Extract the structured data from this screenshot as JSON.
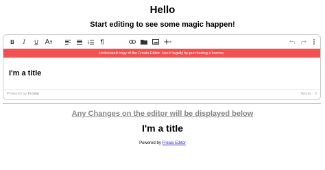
{
  "header": {
    "title": "Hello",
    "subtitle": "Start editing to see some magic happen!"
  },
  "editor": {
    "toolbar": [
      {
        "name": "bold-button",
        "label": "B"
      },
      {
        "name": "italic-button",
        "label": "I"
      },
      {
        "name": "underline-button",
        "label": "U"
      },
      {
        "name": "text-format-button",
        "icon": "text-format-icon"
      },
      {
        "name": "align-left-button",
        "icon": "align-left-icon"
      },
      {
        "name": "align-justify-button",
        "icon": "align-justify-icon"
      },
      {
        "name": "ordered-list-button",
        "icon": "ordered-list-icon"
      },
      {
        "name": "paragraph-format-button",
        "label": "¶"
      },
      {
        "name": "insert-link-button",
        "icon": "link-icon"
      },
      {
        "name": "insert-file-button",
        "icon": "folder-icon"
      },
      {
        "name": "insert-image-button",
        "icon": "image-icon"
      },
      {
        "name": "insert-more-button",
        "icon": "plus-icon"
      },
      {
        "name": "undo-button",
        "icon": "undo-icon"
      },
      {
        "name": "redo-button",
        "icon": "redo-icon"
      },
      {
        "name": "more-options-button",
        "icon": "more-vertical-icon"
      }
    ],
    "warning": "Unlicensed copy of the Froala Editor. Use it legally by purchasing a license.",
    "content": "I'm a title",
    "status": {
      "powered_prefix": "Powered by",
      "powered_brand": "Froala",
      "word_count": "Words : 3"
    }
  },
  "output": {
    "heading": "Any Changes on the editor will be displayed below",
    "rendered_title": "I'm a title",
    "footer_prefix": "Powered by",
    "footer_link": "Froala Editor"
  },
  "colors": {
    "warning_bg": "#f05252",
    "link": "#2a2ae0"
  }
}
